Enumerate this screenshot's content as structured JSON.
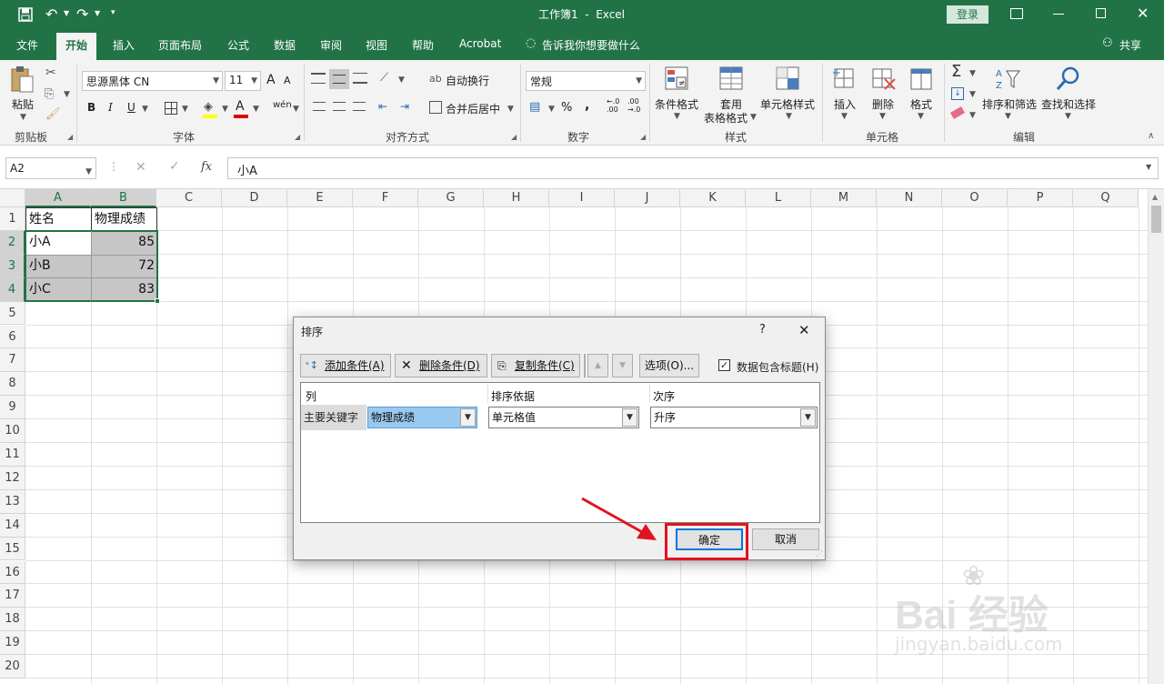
{
  "app": {
    "title": "工作簿1  -  Excel",
    "login_label": "登录",
    "share_label": "共享"
  },
  "tabs": [
    "文件",
    "开始",
    "插入",
    "页面布局",
    "公式",
    "数据",
    "审阅",
    "视图",
    "帮助",
    "Acrobat",
    "告诉我你想要做什么"
  ],
  "ribbon": {
    "clipboard": {
      "paste_label": "粘贴",
      "group_label": "剪贴板"
    },
    "font": {
      "font_name": "思源黑体 CN",
      "font_size": "11",
      "bold": "B",
      "italic": "I",
      "underline": "U",
      "grow": "A",
      "shrink": "A",
      "phonetic": "wén",
      "font_color_letter": "A",
      "group_label": "字体"
    },
    "alignment": {
      "wrap_label": "自动换行",
      "merge_label": "合并后居中",
      "group_label": "对齐方式"
    },
    "number": {
      "format": "常规",
      "percent": "%",
      "comma": ",",
      "inc_decimal": "←.0\n.00",
      "dec_decimal": ".00\n→.0",
      "group_label": "数字"
    },
    "styles": {
      "cond_label": "条件格式",
      "table_label_1": "套用",
      "table_label_2": "表格格式",
      "cell_styles_label": "单元格样式",
      "group_label": "样式"
    },
    "cells": {
      "insert_label": "插入",
      "delete_label": "删除",
      "format_label": "格式",
      "group_label": "单元格"
    },
    "editing": {
      "sort_label": "排序和筛选",
      "find_label": "查找和选择",
      "group_label": "编辑"
    }
  },
  "formula_bar": {
    "name_box": "A2",
    "fx": "fx",
    "content": "小A"
  },
  "columns": [
    "A",
    "B",
    "C",
    "D",
    "E",
    "F",
    "G",
    "H",
    "I",
    "J",
    "K",
    "L",
    "M",
    "N",
    "O",
    "P",
    "Q"
  ],
  "rows": [
    "1",
    "2",
    "3",
    "4",
    "5",
    "6",
    "7",
    "8",
    "9",
    "10",
    "11",
    "12",
    "13",
    "14",
    "15",
    "16",
    "17",
    "18",
    "19",
    "20"
  ],
  "cells": {
    "a1": "姓名",
    "b1": "物理成绩",
    "a2": "小A",
    "b2": "85",
    "a3": "小B",
    "b3": "72",
    "a4": "小C",
    "b4": "83"
  },
  "dialog": {
    "title": "排序",
    "help": "?",
    "close": "✕",
    "add_label": "添加条件(A)",
    "delete_label": "删除条件(D)",
    "copy_label": "复制条件(C)",
    "options_label": "选项(O)...",
    "has_header_label": "数据包含标题(H)",
    "has_header_checked": true,
    "col_header": "列",
    "sort_on_header": "排序依据",
    "order_header": "次序",
    "row_label": "主要关键字",
    "key_value": "物理成绩",
    "sort_on_value": "单元格值",
    "order_value": "升序",
    "ok_label": "确定",
    "cancel_label": "取消"
  },
  "watermark": {
    "main": "Bai 经验",
    "sub": "jingyan.baidu.com"
  },
  "colors": {
    "excel_green": "#217346",
    "highlight_red": "#e0141e",
    "selection_blue": "#99c9ef"
  }
}
